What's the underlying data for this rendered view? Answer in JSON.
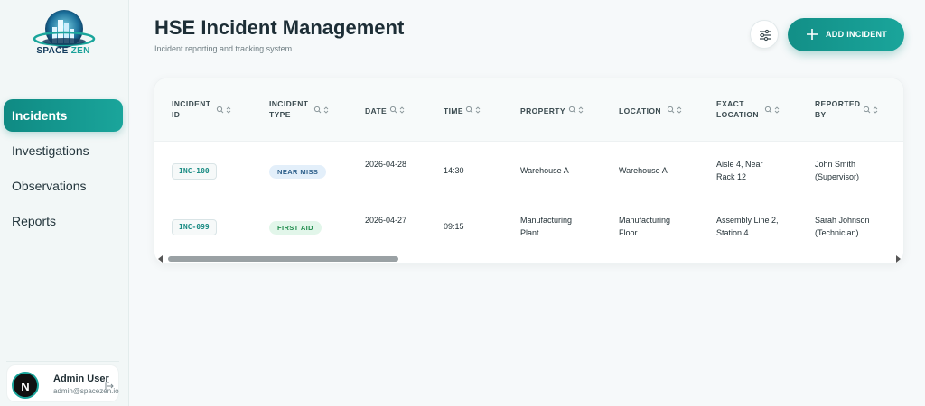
{
  "brand": {
    "name_part1": "SPACE",
    "name_part2": "ZEN",
    "accent": "#1aa59b",
    "navy": "#153d5e"
  },
  "sidebar": {
    "items": [
      {
        "label": "Incidents",
        "active": true
      },
      {
        "label": "Investigations"
      },
      {
        "label": "Observations"
      },
      {
        "label": "Reports"
      }
    ]
  },
  "user": {
    "initial": "N",
    "name": "Admin User",
    "email": "admin@spacezen.io"
  },
  "header": {
    "title": "HSE Incident Management",
    "subtitle": "Incident reporting and tracking system",
    "add_label": "ADD INCIDENT"
  },
  "table": {
    "columns": [
      {
        "label": "INCIDENT ID"
      },
      {
        "label": "INCIDENT TYPE"
      },
      {
        "label": "DATE"
      },
      {
        "label": "TIME"
      },
      {
        "label": "PROPERTY"
      },
      {
        "label": "LOCATION"
      },
      {
        "label": "EXACT LOCATION"
      },
      {
        "label": "REPORTED BY"
      }
    ],
    "rows": [
      {
        "id": "INC-100",
        "type": "NEAR MISS",
        "date": "2026-04-28",
        "time": "14:30",
        "property": "Warehouse A",
        "location": "Warehouse A",
        "exact_location": "Aisle 4, Near Rack 12",
        "reported_by": "John Smith (Supervisor)"
      },
      {
        "id": "INC-099",
        "type": "FIRST AID",
        "date": "2026-04-27",
        "time": "09:15",
        "property": "Manufacturing Plant",
        "location": "Manufacturing Floor",
        "exact_location": "Assembly Line 2, Station 4",
        "reported_by": "Sarah Johnson (Technician)"
      }
    ]
  }
}
